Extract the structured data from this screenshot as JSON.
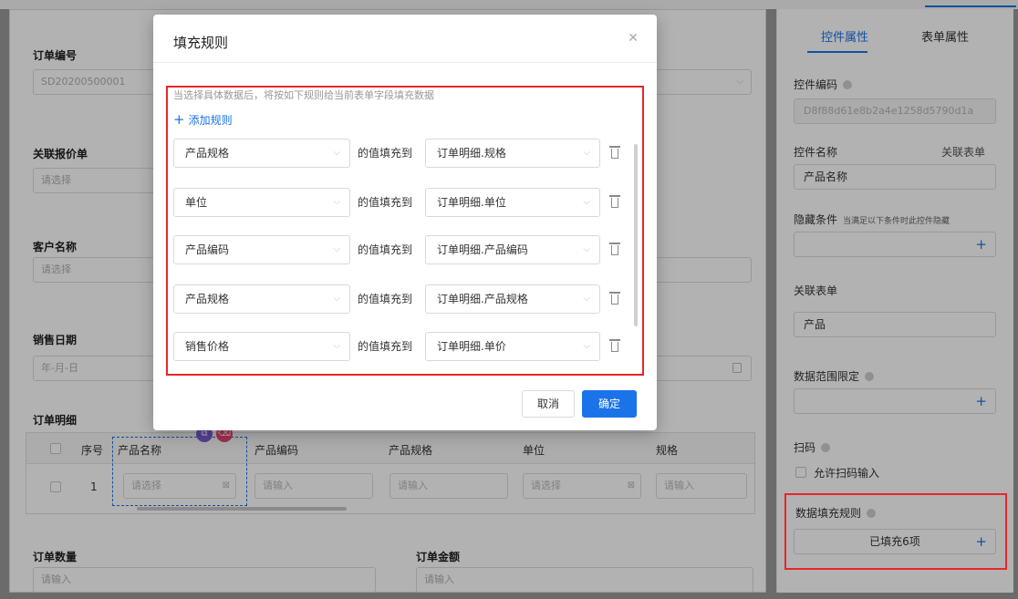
{
  "form": {
    "order_no": {
      "label": "订单编号",
      "value": "SD20200500001"
    },
    "quote": {
      "label": "关联报价单",
      "placeholder": "请选择"
    },
    "customer": {
      "label": "客户名称",
      "placeholder": "请选择"
    },
    "sale_date": {
      "label": "销售日期",
      "placeholder": "年-月-日"
    },
    "detail_label": "订单明细",
    "qty": {
      "label": "订单数量",
      "placeholder": "请输入"
    },
    "amount": {
      "label": "订单金额",
      "placeholder": "请输入"
    }
  },
  "detail_table": {
    "headers": [
      "序号",
      "产品名称",
      "产品编码",
      "产品规格",
      "单位",
      "规格"
    ],
    "row": {
      "index": "1",
      "product_name_placeholder": "请选择",
      "product_code_placeholder": "请输入",
      "spec_placeholder": "请输入",
      "unit_placeholder": "请选择",
      "size_placeholder": "请输入"
    }
  },
  "right_panel": {
    "tabs": [
      "控件属性",
      "表单属性"
    ],
    "active_tab": "控件属性",
    "control_code_label": "控件编码",
    "control_code_value": "D8f88d61e8b2a4e1258d5790d1a",
    "control_name_label": "控件名称",
    "related_form_link": "关联表单",
    "control_name_value": "产品名称",
    "hide_cond_label": "隐藏条件",
    "hide_cond_note": "当满足以下条件时此控件隐藏",
    "related_form_label": "关联表单",
    "related_form_value": "产品",
    "data_range_label": "数据范围限定",
    "scan_label": "扫码",
    "allow_scan_label": "允许扫码输入",
    "fill_rule_label": "数据填充规则",
    "fill_rule_value": "已填充6项"
  },
  "modal": {
    "title": "填充规则",
    "hint": "当选择具体数据后，将按如下规则给当前表单字段填充数据",
    "add_rule": "添加规则",
    "middle_text": "的值填充到",
    "rules": [
      {
        "source": "产品规格",
        "target": "订单明细.规格"
      },
      {
        "source": "单位",
        "target": "订单明细.单位"
      },
      {
        "source": "产品编码",
        "target": "订单明细.产品编码"
      },
      {
        "source": "产品规格",
        "target": "订单明细.产品规格"
      },
      {
        "source": "销售价格",
        "target": "订单明细.单价"
      }
    ],
    "cancel_label": "取消",
    "ok_label": "确定"
  },
  "colors": {
    "accent": "#1a73e8",
    "highlight": "#e8262a"
  }
}
